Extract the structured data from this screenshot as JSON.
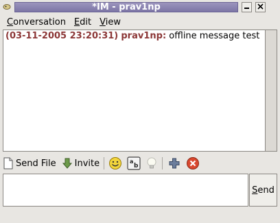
{
  "window": {
    "title": "*IM - prav1np",
    "app_icon": "gaim-icon",
    "minimize_icon": "minimize-icon",
    "close_icon": "close-icon"
  },
  "menu": {
    "conversation_prefix": "",
    "conversation_accel": "C",
    "conversation_rest": "onversation",
    "edit_accel": "E",
    "edit_rest": "dit",
    "view_accel": "V",
    "view_rest": "iew"
  },
  "conversation": {
    "messages": [
      {
        "timestamp": "(03-11-2005 23:20:31)",
        "sender": "prav1np:",
        "text": "offline message test"
      }
    ],
    "sender_color": "#8b3636"
  },
  "toolbar": {
    "send_file_label": "Send File",
    "send_file_icon": "file-icon",
    "invite_label": "Invite",
    "invite_icon": "arrow-down-icon",
    "smiley_icon": "smiley-icon",
    "font_icon": "font-icon",
    "idea_icon": "lightbulb-icon",
    "add_icon": "plus-icon",
    "remove_icon": "remove-icon"
  },
  "entry": {
    "value": ""
  },
  "send": {
    "accel": "S",
    "rest": "end"
  }
}
